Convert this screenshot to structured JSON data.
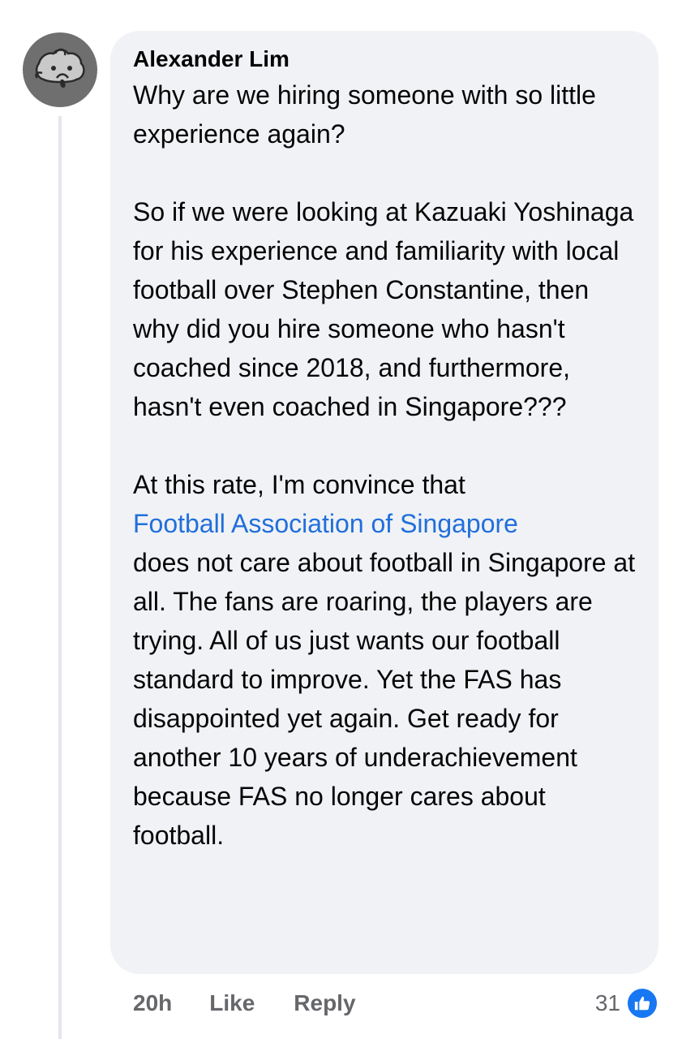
{
  "comment": {
    "author": "Alexander Lim",
    "avatar_icon": "sad-face-avatar-icon",
    "paragraphs": [
      {
        "text": "Why are we hiring someone with so little experience again?"
      },
      {
        "text": "So if we were looking at Kazuaki Yoshinaga for his experience and familiarity with local football over Stephen Constantine, then why did you hire someone who hasn't coached since 2018, and furthermore, hasn't even coached in Singapore???"
      },
      {
        "before": "At this rate, I'm convince that",
        "mention": "Football Association of Singapore",
        "after": "does not care about football in Singapore at all. The fans are roaring, the players are trying. All of us just wants our football standard to improve. Yet the FAS has disappointed yet again. Get ready for another 10 years of underachievement because FAS no longer cares about football."
      }
    ],
    "colors": {
      "bubble": "#f0f2f5",
      "mention": "#216fdb",
      "meta_text": "#65676b",
      "like_badge": "#1877f2"
    }
  },
  "footer": {
    "time": "20h",
    "like_label": "Like",
    "reply_label": "Reply",
    "reaction_count": "31",
    "reaction_icon": "thumbs-up-icon"
  }
}
